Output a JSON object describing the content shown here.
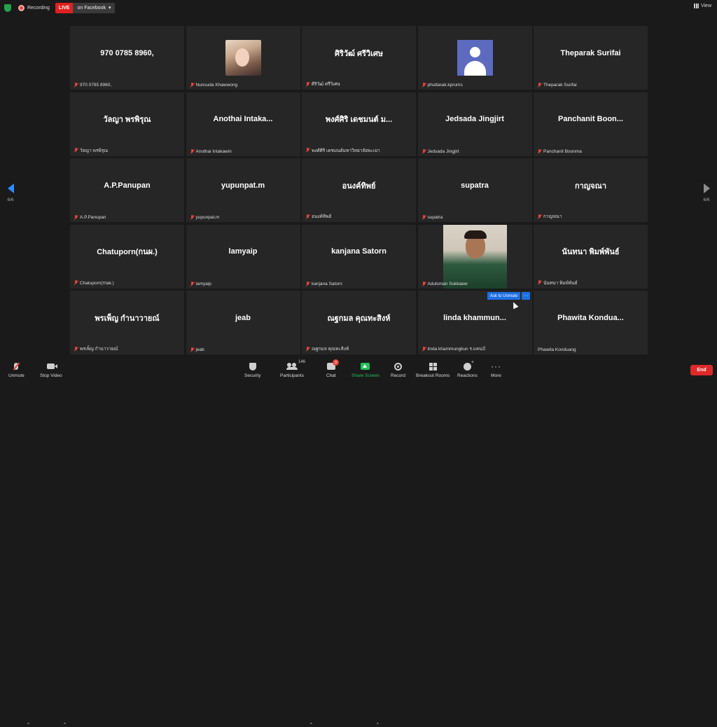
{
  "topbar": {
    "recording_label": "Recording",
    "live_label": "LIVE",
    "live_where": "on Facebook",
    "view_label": "View"
  },
  "pagination": {
    "left": "6/6",
    "right": "6/6"
  },
  "tiles": [
    {
      "display": "970 0785 8960,",
      "name": "970 0785 8960,",
      "kind": "text",
      "muted": true
    },
    {
      "display": "",
      "name": "Nunsuda Khawwong",
      "kind": "photo-girl",
      "muted": true
    },
    {
      "display": "ศิริวัฒ์ ศรีวิเศษ",
      "name": "ศิริวัฒ์ ศรีวิเศษ",
      "kind": "text",
      "muted": true
    },
    {
      "display": "",
      "name": "phuttarak.kprums",
      "kind": "avatar-default",
      "muted": true
    },
    {
      "display": "Theparak Surifai",
      "name": "Theparak Surifai",
      "kind": "text",
      "muted": true
    },
    {
      "display": "วัลญา  พรพิรุณ",
      "name": "วัลญา  พรพิรุณ",
      "kind": "text",
      "muted": true
    },
    {
      "display": "Anothai   Intaka...",
      "name": "Anothai  Intakawin",
      "kind": "text",
      "muted": true
    },
    {
      "display": "พงศ์ศิริ เดชมนต์ ม...",
      "name": "พงศ์ศิริ เดชมนต์มหาวิทยาลัยพะเยา",
      "kind": "text",
      "muted": true
    },
    {
      "display": "Jedsada Jingjirt",
      "name": "Jedsada Jingjirt",
      "kind": "text",
      "muted": true
    },
    {
      "display": "Panchanit  Boon...",
      "name": "Panchanit Boonma",
      "kind": "text",
      "muted": true
    },
    {
      "display": "A.P.Panupan",
      "name": "A.P.Panupan",
      "kind": "text",
      "muted": true
    },
    {
      "display": "yupunpat.m",
      "name": "yupunpat.m",
      "kind": "text",
      "muted": true
    },
    {
      "display": "อนงค์ทิพย์",
      "name": "อนงค์ทิพย์",
      "kind": "text",
      "muted": true
    },
    {
      "display": "supatra",
      "name": "supatra",
      "kind": "text",
      "muted": true
    },
    {
      "display": "กาญจณา",
      "name": "กาญจณา",
      "kind": "text",
      "muted": true
    },
    {
      "display": "Chatuporn(กนผ.)",
      "name": "Chatuporn(กนผ.)",
      "kind": "text",
      "muted": true
    },
    {
      "display": "lamyaip",
      "name": "lamyaip",
      "kind": "text",
      "muted": true
    },
    {
      "display": "kanjana Satorn",
      "name": "kanjana Satorn",
      "kind": "text",
      "muted": true
    },
    {
      "display": "",
      "name": "Adulsman Sukkaew",
      "kind": "photo-man",
      "muted": true
    },
    {
      "display": "นันทนา  พิมพ์พันธ์",
      "name": "นันทนา  พิมพ์พันธ์",
      "kind": "text",
      "muted": true
    },
    {
      "display": "พรเพ็ญ กำนาวายณ์",
      "name": "พรเพ็ญ กำนาวายณ์",
      "kind": "text",
      "muted": true
    },
    {
      "display": "jeab",
      "name": "jeab",
      "kind": "text",
      "muted": true
    },
    {
      "display": "ณฐกมล  คุณทะสิงห์",
      "name": "ณฐกมล  คุณทะสิงห์",
      "kind": "text",
      "muted": true
    },
    {
      "display": "linda  khammun...",
      "name": "linda khammungkun ร.แคนป์",
      "kind": "text",
      "muted": true
    },
    {
      "display": "Phawita  Kondua...",
      "name": "Phawita Konduang",
      "kind": "text",
      "muted": false
    }
  ],
  "ask_unmute": {
    "label": "Ask to Unmute",
    "more": "···"
  },
  "toolbar": {
    "unmute": "Unmute",
    "stop_video": "Stop Video",
    "security": "Security",
    "participants": "Participants",
    "participants_count": "146",
    "chat": "Chat",
    "chat_badge": "3",
    "share_screen": "Share Screen",
    "record": "Record",
    "breakout": "Breakout Rooms",
    "reactions": "Reactions",
    "more": "More",
    "end": "End"
  },
  "colors": {
    "live": "#e02020",
    "share": "#23c25a",
    "end": "#e02828",
    "accent": "#1d6fe3"
  }
}
